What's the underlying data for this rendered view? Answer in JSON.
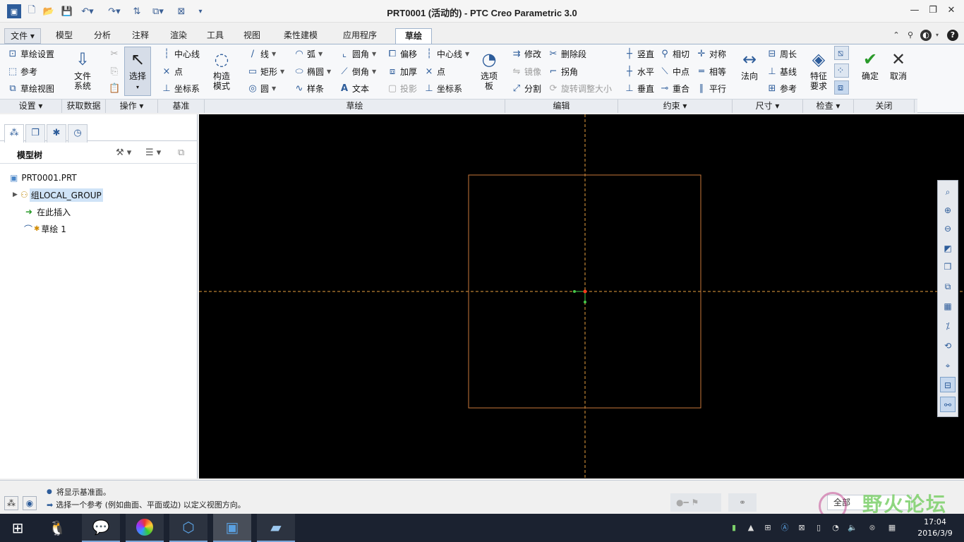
{
  "window": {
    "title": "PRT0001 (活动的) - PTC Creo Parametric 3.0",
    "minimize": "—",
    "restore": "❐",
    "close": "✕"
  },
  "quick_access": [
    "new-icon",
    "open-icon",
    "save-icon",
    "undo-icon",
    "redo-icon",
    "regenerate-icon",
    "windows-icon",
    "close-window-icon",
    "customize-icon"
  ],
  "tabs": [
    "文件",
    "模型",
    "分析",
    "注释",
    "渲染",
    "工具",
    "视图",
    "柔性建模",
    "应用程序",
    "草绘"
  ],
  "active_tab": "草绘",
  "ribbon": {
    "setup": {
      "sketch_setup": "草绘设置",
      "references": "参考",
      "sketch_view": "草绘视图"
    },
    "get_data": {
      "file_system": "文件\n系统"
    },
    "operations": {
      "select": "选择"
    },
    "datum": {
      "centerline": "中心线",
      "point": "点",
      "coord": "坐标系"
    },
    "construction_mode": "构造\n模式",
    "sketching": {
      "line": "线",
      "rectangle": "矩形",
      "circle": "圆",
      "arc": "弧",
      "ellipse": "椭圆",
      "spline": "样条",
      "fillet": "圆角",
      "chamfer": "倒角",
      "text": "文本",
      "offset": "偏移",
      "thicken": "加厚",
      "project": "投影",
      "centerline": "中心线",
      "point": "点",
      "coord": "坐标系",
      "palette": "选项\n板"
    },
    "editing": {
      "modify": "修改",
      "delete_segment": "删除段",
      "mirror": "镜像",
      "corner": "拐角",
      "divide": "分割",
      "rotate_resize": "旋转调整大小"
    },
    "constrain": {
      "vertical": "竖直",
      "tangent": "相切",
      "symmetric": "对称",
      "horizontal": "水平",
      "midpoint": "中点",
      "equal": "相等",
      "perpendicular": "垂直",
      "coincident": "重合",
      "parallel": "平行"
    },
    "dimension": {
      "normal": "法向",
      "perimeter": "周长",
      "baseline": "基线",
      "reference": "参考"
    },
    "inspect": {
      "feature_requirements": "特征\n要求"
    },
    "close": {
      "ok": "确定",
      "cancel": "取消"
    },
    "groups": [
      "设置",
      "获取数据",
      "操作",
      "基准",
      "草绘",
      "编辑",
      "约束",
      "尺寸",
      "检查",
      "关闭"
    ]
  },
  "model_tree": {
    "header": "模型树",
    "nodes": [
      "PRT0001.PRT",
      "组LOCAL_GROUP",
      "在此插入",
      "草绘 1"
    ]
  },
  "status": {
    "messages": [
      "将显示基准面。",
      "选择一个参考 (例如曲面、平面或边) 以定义视图方向。"
    ],
    "filter": "全部"
  },
  "watermark": "野火论坛",
  "clock": {
    "time": "17:04",
    "date": "2016/3/9"
  },
  "colors": {
    "canvas": "#000000",
    "sketch_line": "#c8773a",
    "centerline": "#e8a040",
    "point_red": "#ff3a1a",
    "point_green": "#46c84a",
    "accent": "#2d5c9a"
  }
}
